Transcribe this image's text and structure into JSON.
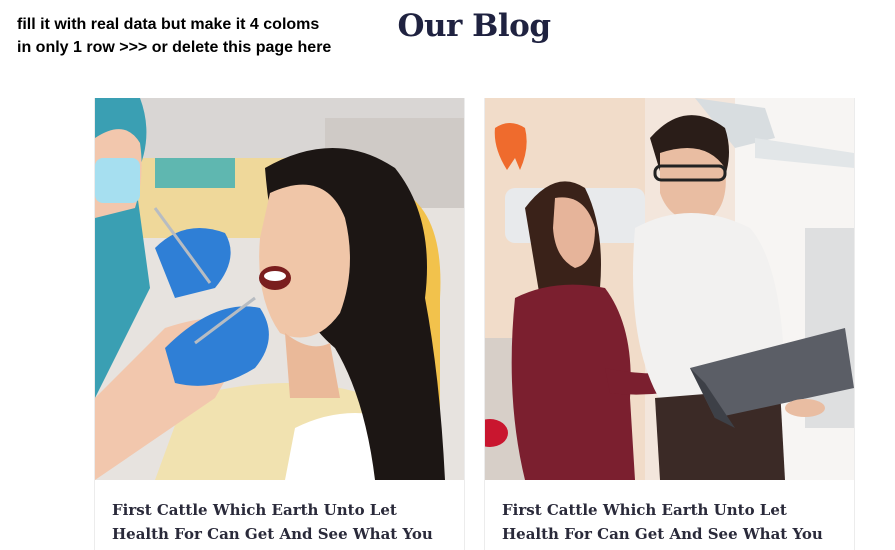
{
  "note": {
    "line1": "fill it with real data but make it 4 coloms",
    "line2": "in only 1 row >>> or delete this page here"
  },
  "section": {
    "title": "Our Blog"
  },
  "posts": [
    {
      "title": "First Cattle Which Earth Unto Let Health For Can Get And See What You",
      "image": "dental-patient-photo"
    },
    {
      "title": "First Cattle Which Earth Unto Let Health For Can Get And See What You",
      "image": "dentist-couple-laptop-photo"
    }
  ]
}
